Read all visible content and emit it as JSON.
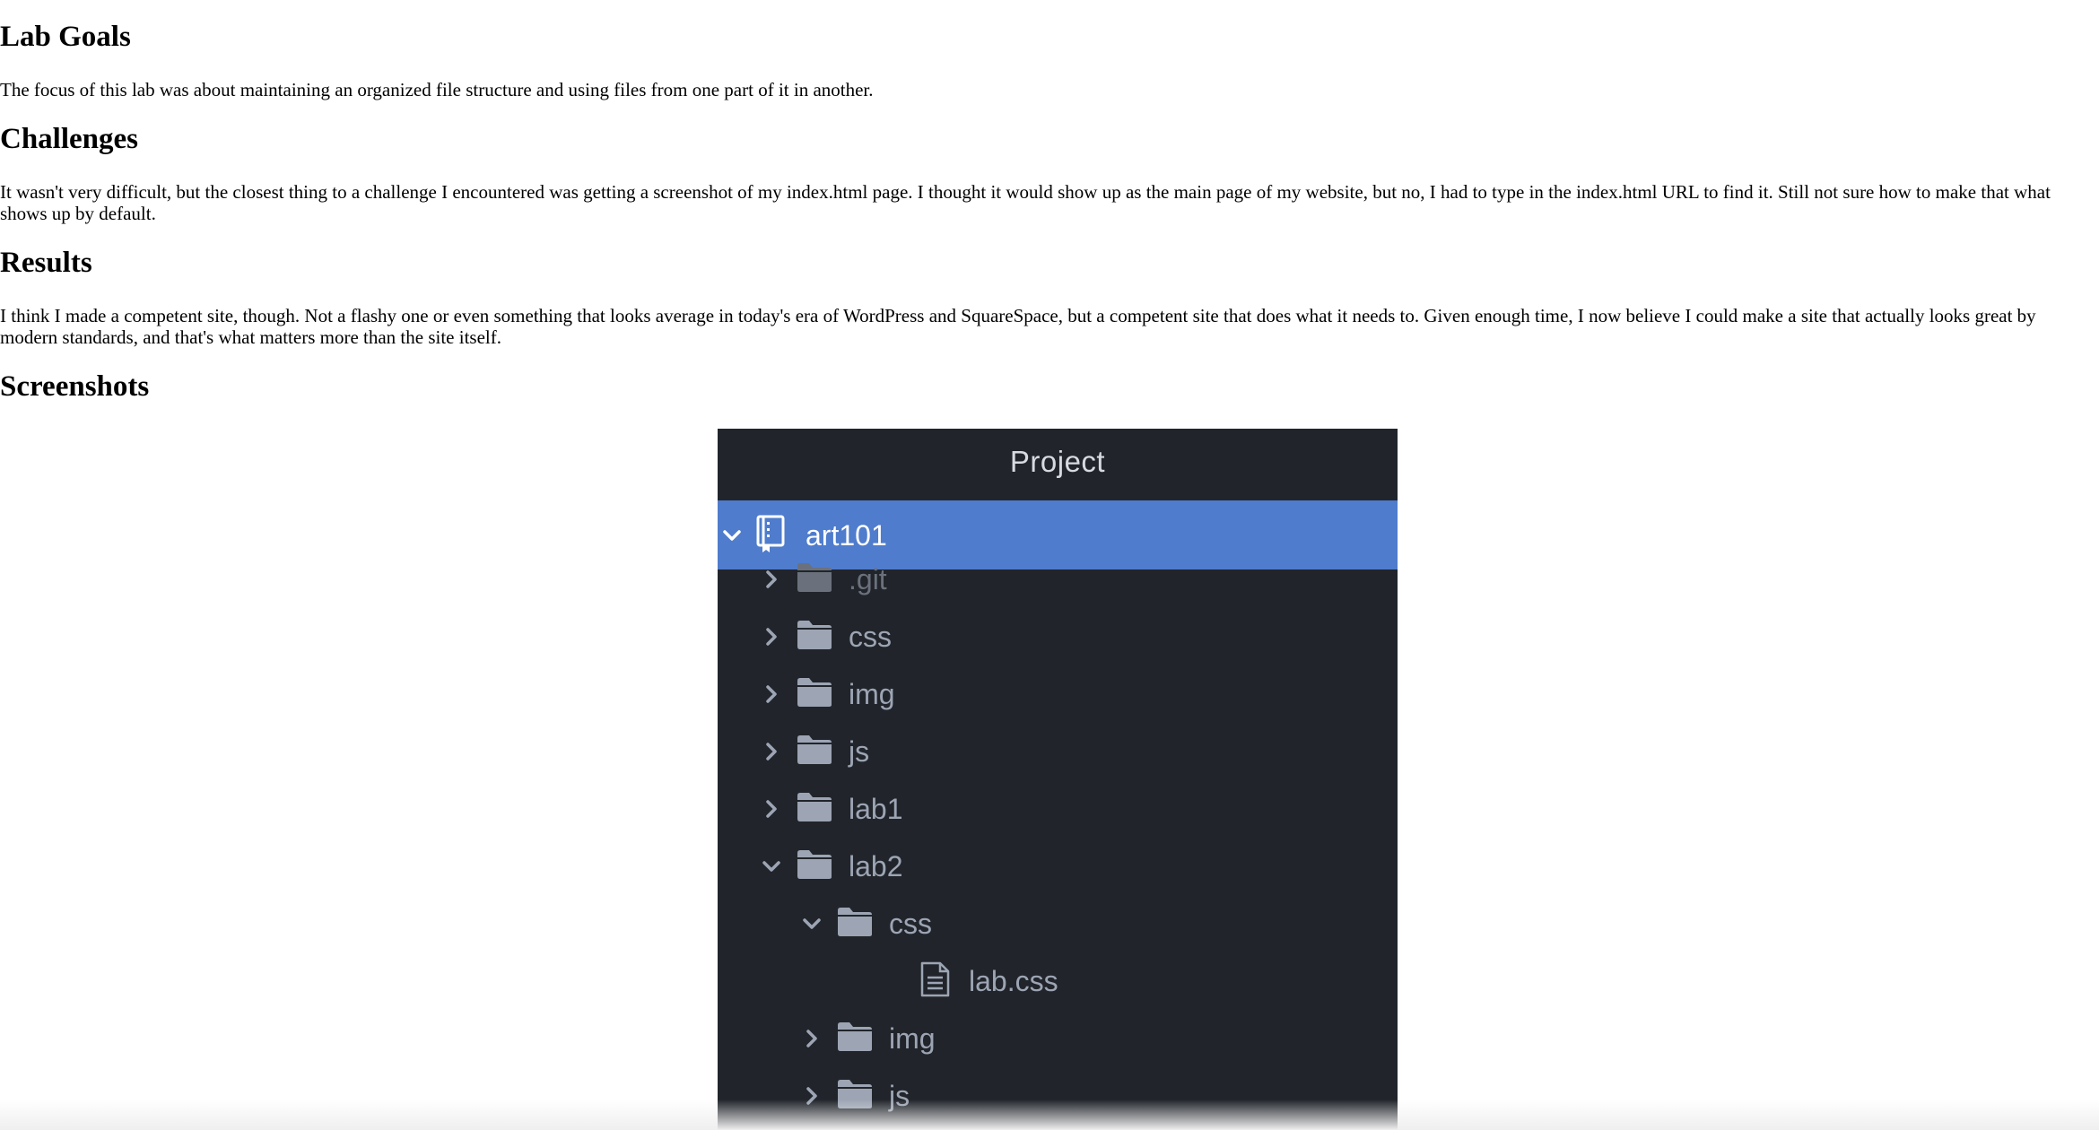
{
  "sections": {
    "goals": {
      "heading": "Lab Goals",
      "text": "The focus of this lab was about maintaining an organized file structure and using files from one part of it in another."
    },
    "challenges": {
      "heading": "Challenges",
      "text": "It wasn't very difficult, but the closest thing to a challenge I encountered was getting a screenshot of my index.html page. I thought it would show up as the main page of my website, but no, I had to type in the index.html URL to find it. Still not sure how to make that what shows up by default."
    },
    "results": {
      "heading": "Results",
      "text": "I think I made a competent site, though. Not a flashy one or even something that looks average in today's era of WordPress and SquareSpace, but a competent site that does what it needs to. Given enough time, I now believe I could make a site that actually looks great by modern standards, and that's what matters more than the site itself."
    },
    "screenshots": {
      "heading": "Screenshots"
    }
  },
  "project_panel": {
    "title": "Project",
    "colors": {
      "background": "#21252b",
      "selected_row": "#4f7ccc",
      "text": "#9da5b4",
      "dim_text": "#6b717c"
    },
    "root": {
      "label": "art101",
      "icon": "repo-icon",
      "expanded": true
    },
    "items": [
      {
        "label": ".git",
        "icon": "folder-icon",
        "expanded": false,
        "dim": true
      },
      {
        "label": "css",
        "icon": "folder-icon",
        "expanded": false
      },
      {
        "label": "img",
        "icon": "folder-icon",
        "expanded": false
      },
      {
        "label": "js",
        "icon": "folder-icon",
        "expanded": false
      },
      {
        "label": "lab1",
        "icon": "folder-icon",
        "expanded": false
      },
      {
        "label": "lab2",
        "icon": "folder-icon",
        "expanded": true
      },
      {
        "label": "css",
        "icon": "folder-icon",
        "expanded": true
      },
      {
        "label": "lab.css",
        "icon": "file-icon"
      },
      {
        "label": "img",
        "icon": "folder-icon",
        "expanded": false
      },
      {
        "label": "js",
        "icon": "folder-icon",
        "expanded": false
      }
    ]
  }
}
